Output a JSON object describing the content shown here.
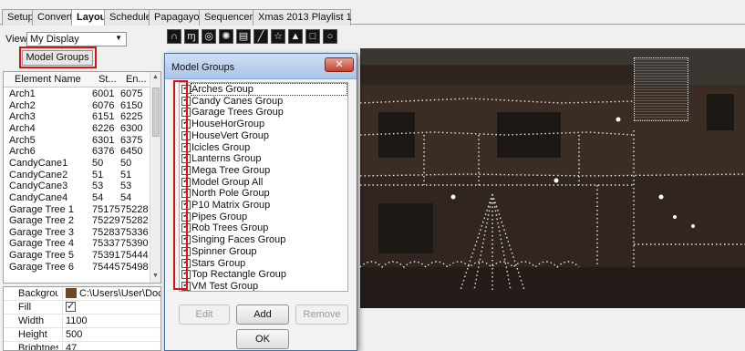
{
  "tabs": [
    "Setup",
    "Convert",
    "Layout",
    "Schedule",
    "Papagayo",
    "Sequencer",
    "Xmas 2013 Playlist 1"
  ],
  "active_tab": "Layout",
  "view": {
    "label": "View:",
    "selected": "My Display"
  },
  "model_groups_button": "Model Groups",
  "element_list": {
    "headers": [
      "Element Name",
      "St...",
      "En..."
    ],
    "rows": [
      [
        "Arch1",
        "6001",
        "6075"
      ],
      [
        "Arch2",
        "6076",
        "6150"
      ],
      [
        "Arch3",
        "6151",
        "6225"
      ],
      [
        "Arch4",
        "6226",
        "6300"
      ],
      [
        "Arch5",
        "6301",
        "6375"
      ],
      [
        "Arch6",
        "6376",
        "6450"
      ],
      [
        "CandyCane1",
        "50",
        "50"
      ],
      [
        "CandyCane2",
        "51",
        "51"
      ],
      [
        "CandyCane3",
        "53",
        "53"
      ],
      [
        "CandyCane4",
        "54",
        "54"
      ],
      [
        "Garage Tree 1",
        "75175",
        "75228"
      ],
      [
        "Garage Tree 2",
        "75229",
        "75282"
      ],
      [
        "Garage Tree 3",
        "75283",
        "75336"
      ],
      [
        "Garage Tree 4",
        "75337",
        "75390"
      ],
      [
        "Garage Tree 5",
        "75391",
        "75444"
      ],
      [
        "Garage Tree 6",
        "75445",
        "75498"
      ]
    ]
  },
  "properties": {
    "background_label": "Backgroun",
    "background_value": "C:\\Users\\User\\Documen",
    "fill_label": "Fill",
    "width_label": "Width",
    "width_value": "1100",
    "height_label": "Height",
    "height_value": "500",
    "brightness_label": "Brightness",
    "brightness_value": "47"
  },
  "dialog": {
    "title": "Model Groups",
    "close": "✕",
    "groups": [
      "Arches Group",
      "Candy Canes Group",
      "Garage Trees Group",
      "HouseHorGroup",
      "HouseVert Group",
      "Icicles Group",
      "Lanterns Group",
      "Mega Tree Group",
      "Model Group All",
      "North Pole Group",
      "P10 Matrix Group",
      "Pipes Group",
      "Rob Trees Group",
      "Singing Faces Group",
      "Spinner Group",
      "Stars Group",
      "Top Rectangle Group",
      "VM Test Group"
    ],
    "edit": "Edit",
    "add": "Add",
    "remove": "Remove",
    "ok": "OK"
  },
  "toolbar_icons": [
    "arch-icon",
    "candy-cane-icon",
    "circle-icon",
    "star-burst-icon",
    "matrix-icon",
    "line-icon",
    "star-icon",
    "tree-icon",
    "square-icon",
    "circle-outline-icon"
  ],
  "colors": {
    "highlight": "#d11111",
    "title_bar": "#a9c4e6",
    "close_button": "#c4402a"
  }
}
